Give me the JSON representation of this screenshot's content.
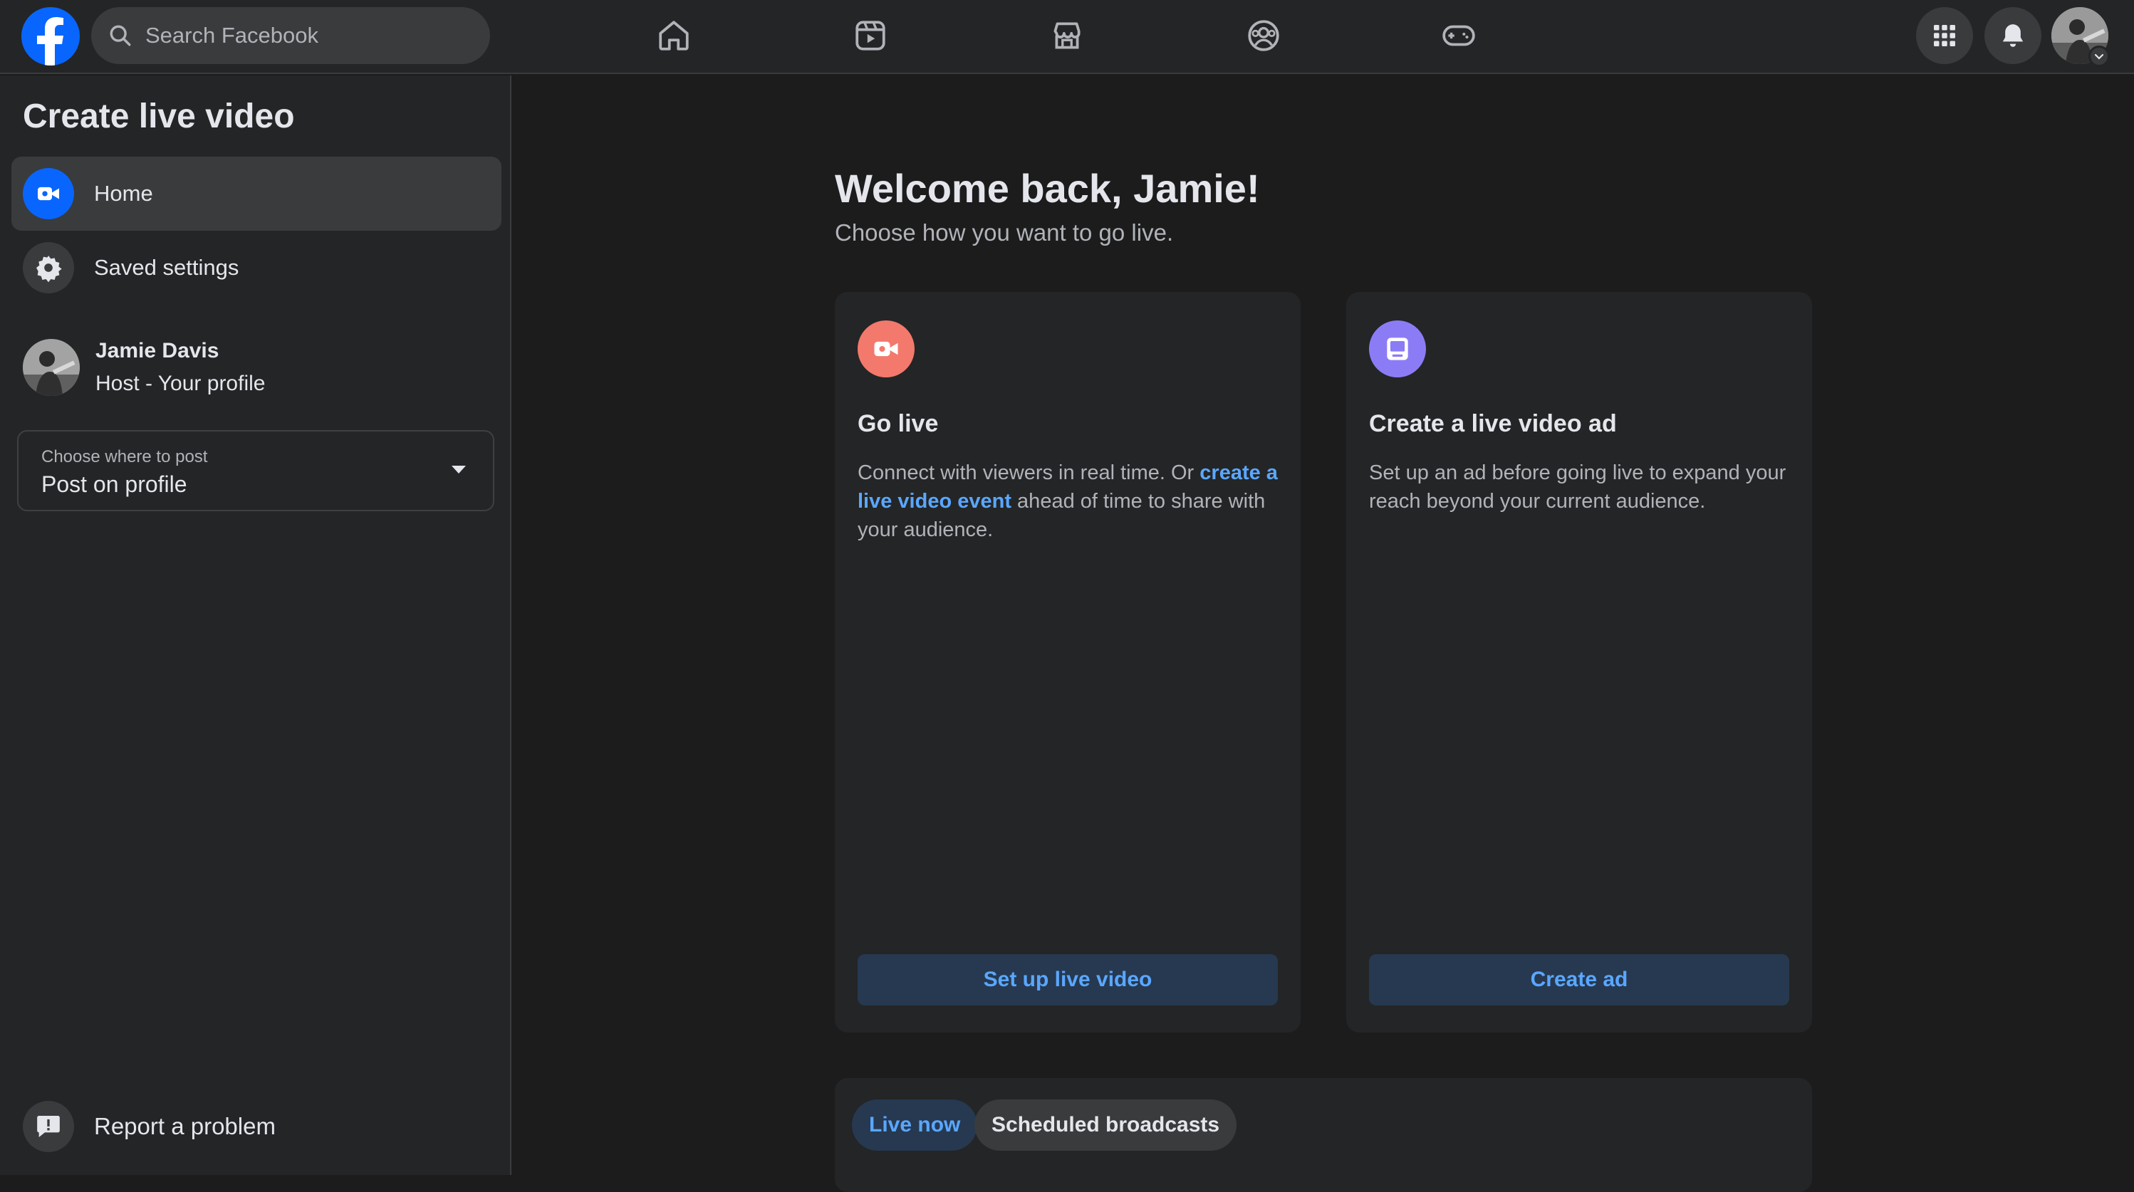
{
  "header": {
    "search_placeholder": "Search Facebook",
    "nav_icons": [
      "home-icon",
      "video-icon",
      "marketplace-icon",
      "groups-icon",
      "gaming-icon"
    ],
    "right_icons": [
      "menu-grid-icon",
      "notifications-bell-icon",
      "account-avatar"
    ]
  },
  "sidebar": {
    "title": "Create live video",
    "items": [
      {
        "label": "Home",
        "icon": "video-camera-icon",
        "active": true
      },
      {
        "label": "Saved settings",
        "icon": "gear-icon",
        "active": false
      }
    ],
    "host": {
      "name": "Jamie Davis",
      "role": "Host - Your profile"
    },
    "post_select": {
      "label": "Choose where to post",
      "value": "Post on profile"
    },
    "report": {
      "label": "Report a problem",
      "icon": "report-alert-icon"
    }
  },
  "main": {
    "welcome": "Welcome back, Jamie!",
    "subtitle": "Choose how you want to go live.",
    "cards": [
      {
        "title": "Go live",
        "desc_before": "Connect with viewers in real time. Or ",
        "desc_link": "create a live video event",
        "desc_after": " ahead of time to share with your audience.",
        "button": "Set up live video",
        "icon": "video-camera-icon",
        "icon_color": "#f3796c"
      },
      {
        "title": "Create a live video ad",
        "desc": "Set up an ad before going live to expand your reach beyond your current audience.",
        "button": "Create ad",
        "icon": "monitor-icon",
        "icon_color": "#8b7cf6"
      }
    ],
    "tabs": [
      {
        "label": "Live now",
        "active": true
      },
      {
        "label": "Scheduled broadcasts",
        "active": false
      }
    ]
  },
  "colors": {
    "brand": "#0866ff",
    "link": "#5aa7ff",
    "background": "#1c1c1d",
    "surface": "#242526"
  }
}
